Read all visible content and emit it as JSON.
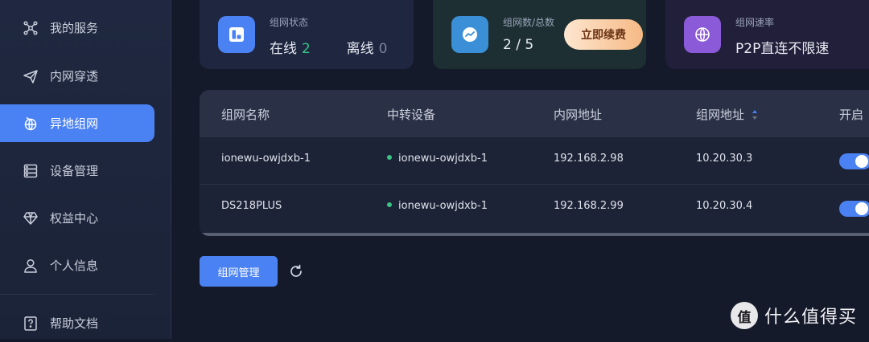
{
  "sidebar": {
    "items": [
      {
        "label": "我的服务",
        "icon": "network-nodes-icon"
      },
      {
        "label": "内网穿透",
        "icon": "paper-plane-icon"
      },
      {
        "label": "异地组网",
        "icon": "globe-link-icon"
      },
      {
        "label": "设备管理",
        "icon": "server-icon"
      },
      {
        "label": "权益中心",
        "icon": "diamond-icon"
      },
      {
        "label": "个人信息",
        "icon": "user-icon"
      },
      {
        "label": "帮助文档",
        "icon": "help-doc-icon"
      }
    ],
    "active": "异地组网"
  },
  "cards": {
    "status": {
      "label": "组网状态",
      "online_label": "在线",
      "online_count": "2",
      "offline_label": "离线",
      "offline_count": "0",
      "icon": "layout-icon",
      "color": "#4b82f3"
    },
    "count": {
      "label": "组网数/总数",
      "value": "2 / 5",
      "button": "立即续费",
      "icon": "trend-icon",
      "color": "#3a8fd6"
    },
    "speed": {
      "label": "组网速率",
      "value": "P2P直连不限速",
      "icon": "globe-icon",
      "color": "#8a5ad8"
    }
  },
  "table": {
    "headers": [
      "组网名称",
      "中转设备",
      "内网地址",
      "组网地址",
      "开启"
    ],
    "rows": [
      {
        "name": "ionewu-owjdxb-1",
        "relay": "ionewu-owjdxb-1",
        "lan_ip": "192.168.2.98",
        "net_ip": "10.20.30.3",
        "enabled": true
      },
      {
        "name": "DS218PLUS",
        "relay": "ionewu-owjdxb-1",
        "lan_ip": "192.168.2.99",
        "net_ip": "10.20.30.4",
        "enabled": true
      }
    ]
  },
  "actions": {
    "manage_label": "组网管理"
  },
  "watermark": {
    "text": "什么值得买",
    "logo_char": "值"
  },
  "colors": {
    "accent": "#4b82f3",
    "online": "#39c384"
  }
}
